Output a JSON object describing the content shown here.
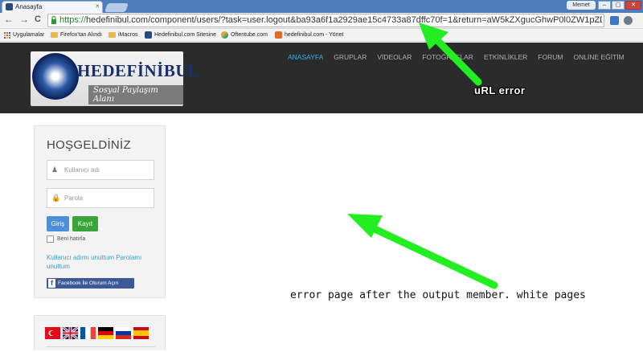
{
  "browser": {
    "tab": {
      "title": "Anasayfa",
      "close": "×"
    },
    "user_chip": "Memet",
    "window_buttons": [
      "–",
      "▢",
      "✕"
    ],
    "nav": {
      "back": "←",
      "forward": "→",
      "reload": "C"
    },
    "url": {
      "scheme": "https://",
      "rest": "hedefinibul.com/component/users/?task=user.logout&ba93a6f1a2929ae15c4733a87dffc70f=1&return=aW5kZXgucGhwP0l0ZW1pZD0xMDI"
    },
    "star": "☆",
    "bookmarks": [
      "Uygulamalar",
      "Firefox'tan Alındı",
      "iMacros",
      "Hedefinibul.com Sitesine",
      "Oftentube.com",
      "hedefinibul.com - Yönet"
    ]
  },
  "site": {
    "logo": {
      "name": "HEDEFİNİBUL",
      "tagline": "Sosyal Paylaşım Alanı"
    },
    "menu": [
      "ANASAYFA",
      "GRUPLAR",
      "VİDEOLAR",
      "FOTOĞRAFLAR",
      "ETKİNLİKLER",
      "FORUM",
      "ONLİNE EĞİTİM"
    ]
  },
  "login": {
    "title": "HOŞGELDİNİZ",
    "username_placeholder": "Kullanıcı adı",
    "password_placeholder": "Parola",
    "login_button": "Giriş",
    "register_button": "Kayıt",
    "remember_label": "Beni hatırla",
    "forgot_links": "Kullanıcı adımı unuttum  Parolamı unuttum",
    "facebook_button": "Facebook İle Oturum Açın"
  },
  "annotations": {
    "url_error": "uRL error",
    "error_note": "error page after the output member. white pages"
  },
  "colors": {
    "arrow": "#22ee22",
    "menu_active": "#3fb0e8",
    "login_blue": "#4d8ed8",
    "register_green": "#3aa33a",
    "facebook": "#3b5998"
  }
}
